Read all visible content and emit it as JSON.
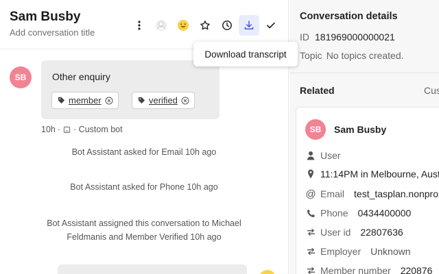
{
  "header": {
    "title": "Sam Busby",
    "subtitle": "Add conversation title"
  },
  "tooltip": "Download transcript",
  "message": {
    "avatar_initials": "SB",
    "text": "Other enquiry",
    "tags": [
      "member",
      "verified"
    ],
    "meta_time": "10h",
    "meta_sep": "·",
    "meta_source": "· Custom bot"
  },
  "system_messages": [
    "Bot Assistant asked for Email 10h ago",
    "Bot Assistant asked for Phone 10h ago",
    "Bot Assistant assigned this conversation to Michael",
    "Feldmanis and Member Verified 10h ago"
  ],
  "details": {
    "title": "Conversation details",
    "id_label": "ID",
    "id_value": "181969000000021",
    "topic_label": "Topic",
    "topic_value": "No topics created."
  },
  "related": {
    "title": "Related",
    "tab_partial": "Cus",
    "contact": {
      "initials": "SB",
      "name": "Sam Busby",
      "type": "User",
      "location": "11:14PM in Melbourne, Aust",
      "email_label": "Email",
      "email_value": "test_tasplan.nonpro",
      "phone_label": "Phone",
      "phone_value": "0434400000",
      "userid_label": "User id",
      "userid_value": "22807636",
      "employer_label": "Employer",
      "employer_value": "Unknown",
      "member_label": "Member number",
      "member_value": "220876"
    }
  },
  "colors": {
    "accent": "#4a5bd6",
    "avatar": "#f28393"
  }
}
